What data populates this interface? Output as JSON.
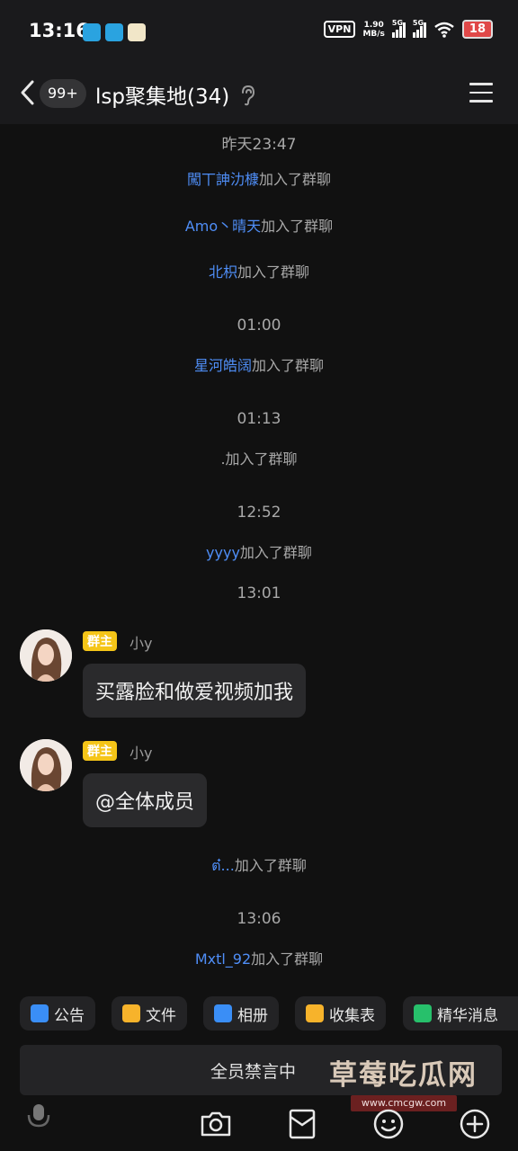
{
  "status_bar": {
    "time": "13:16",
    "vpn": "VPN",
    "speed_value": "1.90",
    "speed_unit": "MB/s",
    "network_1": "5G",
    "network_2": "5G",
    "battery": "18"
  },
  "header": {
    "unread_count": "99+",
    "title": "lsp聚集地(34)"
  },
  "chat": {
    "timestamps": [
      "昨天23:47",
      "01:00",
      "01:13",
      "12:52",
      "13:01",
      "13:06"
    ],
    "joined_suffix": "加入了群聊",
    "joins": [
      {
        "name": "闖丅訷氻槺"
      },
      {
        "name": "Amo丶晴天"
      },
      {
        "name": "北枳"
      },
      {
        "name": "星河皓阔"
      },
      {
        "name": "."
      },
      {
        "name": "yyyy"
      },
      {
        "name": "ต๋..."
      },
      {
        "name": "Mxtl_92"
      }
    ],
    "messages": [
      {
        "badge": "群主",
        "sender": "小y",
        "text": "买露脸和做爱视频加我"
      },
      {
        "badge": "群主",
        "sender": "小y",
        "text": "@全体成员"
      }
    ]
  },
  "quick_bar": {
    "items": [
      {
        "label": "公告",
        "icon": "announcement-icon",
        "color": "#3a8ef6"
      },
      {
        "label": "文件",
        "icon": "folder-icon",
        "color": "#f7b32b"
      },
      {
        "label": "相册",
        "icon": "album-icon",
        "color": "#3a8ef6"
      },
      {
        "label": "收集表",
        "icon": "form-icon",
        "color": "#f7b32b"
      },
      {
        "label": "精华消息",
        "icon": "essence-icon",
        "color": "#27c06b"
      }
    ]
  },
  "input": {
    "mute_text": "全员禁言中"
  },
  "watermark": {
    "text": "草莓吃瓜网",
    "url": "www.cmcgw.com"
  },
  "toolbar": {
    "icons": [
      "microphone-icon",
      "camera-icon",
      "red-packet-icon",
      "emoji-icon",
      "plus-icon"
    ]
  },
  "colors": {
    "background": "#111111",
    "link": "#4f8ef7",
    "owner_badge": "#f5c518",
    "bubble": "#2a2a2c"
  }
}
